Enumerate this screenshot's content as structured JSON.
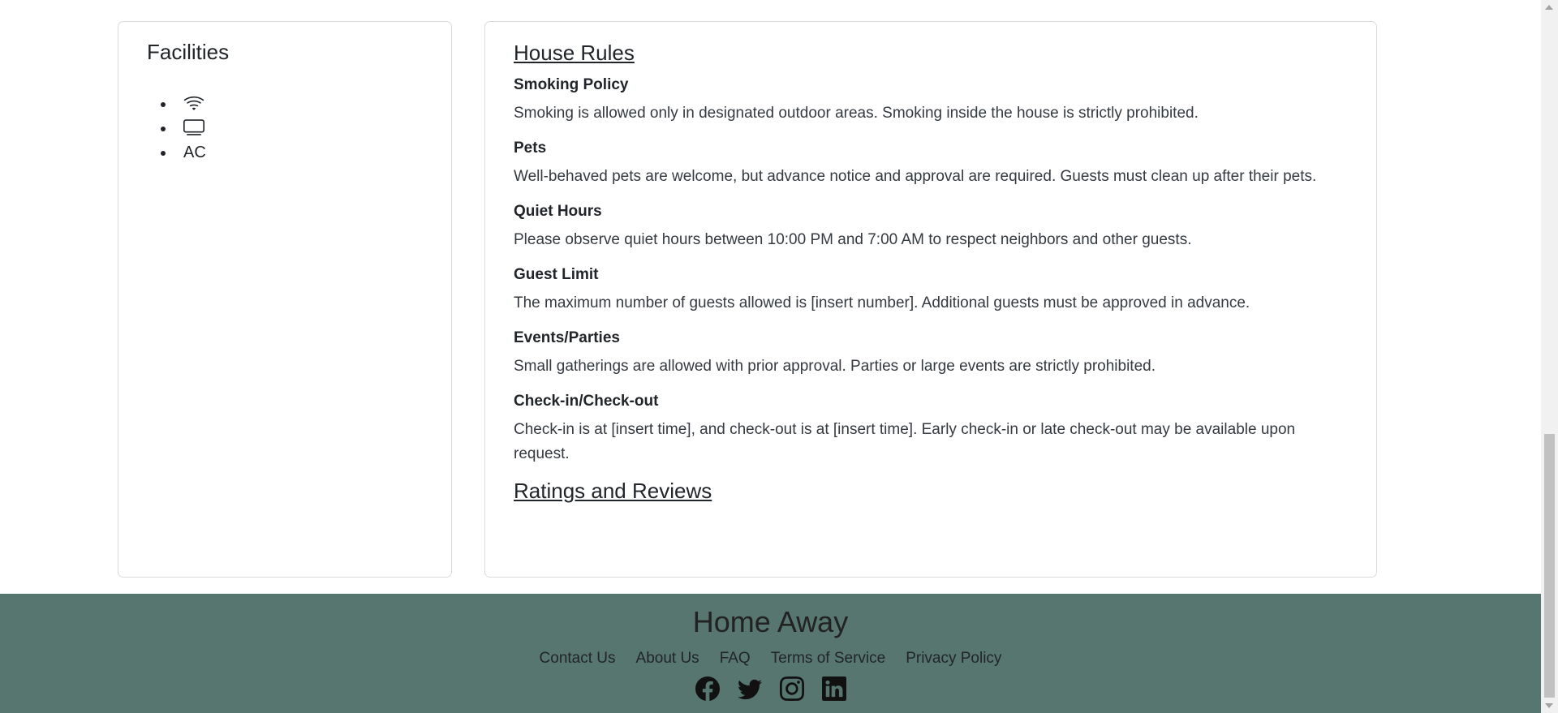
{
  "facilities": {
    "title": "Facilities",
    "items": [
      {
        "icon": "wifi-icon",
        "label": ""
      },
      {
        "icon": "tv-icon",
        "label": ""
      },
      {
        "icon": "",
        "label": "AC"
      }
    ]
  },
  "house_rules": {
    "title": "House Rules",
    "rules": [
      {
        "heading": "Smoking Policy",
        "text": "Smoking is allowed only in designated outdoor areas. Smoking inside the house is strictly prohibited."
      },
      {
        "heading": "Pets",
        "text": "Well-behaved pets are welcome, but advance notice and approval are required. Guests must clean up after their pets."
      },
      {
        "heading": "Quiet Hours",
        "text": "Please observe quiet hours between 10:00 PM and 7:00 AM to respect neighbors and other guests."
      },
      {
        "heading": "Guest Limit",
        "text": "The maximum number of guests allowed is [insert number]. Additional guests must be approved in advance."
      },
      {
        "heading": "Events/Parties",
        "text": "Small gatherings are allowed with prior approval. Parties or large events are strictly prohibited."
      },
      {
        "heading": "Check-in/Check-out",
        "text": "Check-in is at [insert time], and check-out is at [insert time]. Early check-in or late check-out may be available upon request."
      }
    ]
  },
  "ratings": {
    "title": "Ratings and Reviews"
  },
  "footer": {
    "brand": "Home Away",
    "links": [
      "Contact Us",
      "About Us",
      "FAQ",
      "Terms of Service",
      "Privacy Policy"
    ],
    "social_icons": [
      "facebook-icon",
      "twitter-icon",
      "instagram-icon",
      "linkedin-icon"
    ]
  },
  "colors": {
    "footer_bg": "#56766f",
    "text": "#212529",
    "card_border": "#d9dcdf"
  }
}
